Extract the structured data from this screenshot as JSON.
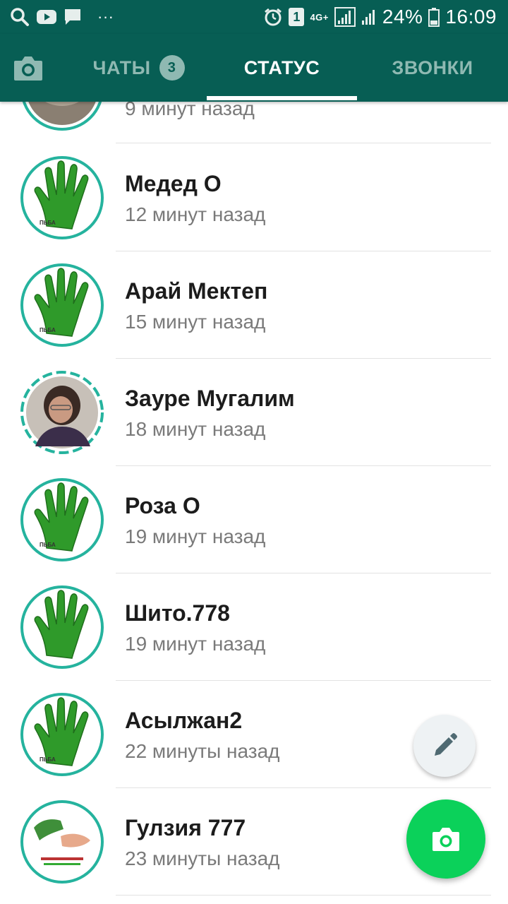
{
  "status_bar": {
    "battery": "24%",
    "time": "16:09",
    "network": "4G+",
    "sim": "1",
    "dots": "···"
  },
  "tabs": [
    {
      "label": "ЧАТЫ",
      "badge": "3"
    },
    {
      "label": "СТАТУС"
    },
    {
      "label": "ЗВОНКИ"
    }
  ],
  "statuses": [
    {
      "name": "",
      "time": "9 минут назад",
      "avatar": "bowl-photo",
      "ring": "seen"
    },
    {
      "name": "Медед О",
      "time": "12 минут назад",
      "avatar": "green-hand",
      "ring": "seen"
    },
    {
      "name": "Арай Мектеп",
      "time": "15 минут назад",
      "avatar": "green-hand",
      "ring": "seen"
    },
    {
      "name": "Зауре Мугалим",
      "time": "18 минут назад",
      "avatar": "woman-photo",
      "ring": "dashed"
    },
    {
      "name": "Роза О",
      "time": "19 минут назад",
      "avatar": "green-hand",
      "ring": "seen"
    },
    {
      "name": "Шито.778",
      "time": "19 минут назад",
      "avatar": "green-hand",
      "ring": "seen"
    },
    {
      "name": "Асылжан2",
      "time": "22 минуты назад",
      "avatar": "green-hand",
      "ring": "seen"
    },
    {
      "name": "Гулзия 777",
      "time": "23 минуты назад",
      "avatar": "handshake-image",
      "ring": "seen"
    }
  ],
  "colors": {
    "header": "#075e54",
    "ring": "#25b39e",
    "fab": "#0bd15a"
  }
}
